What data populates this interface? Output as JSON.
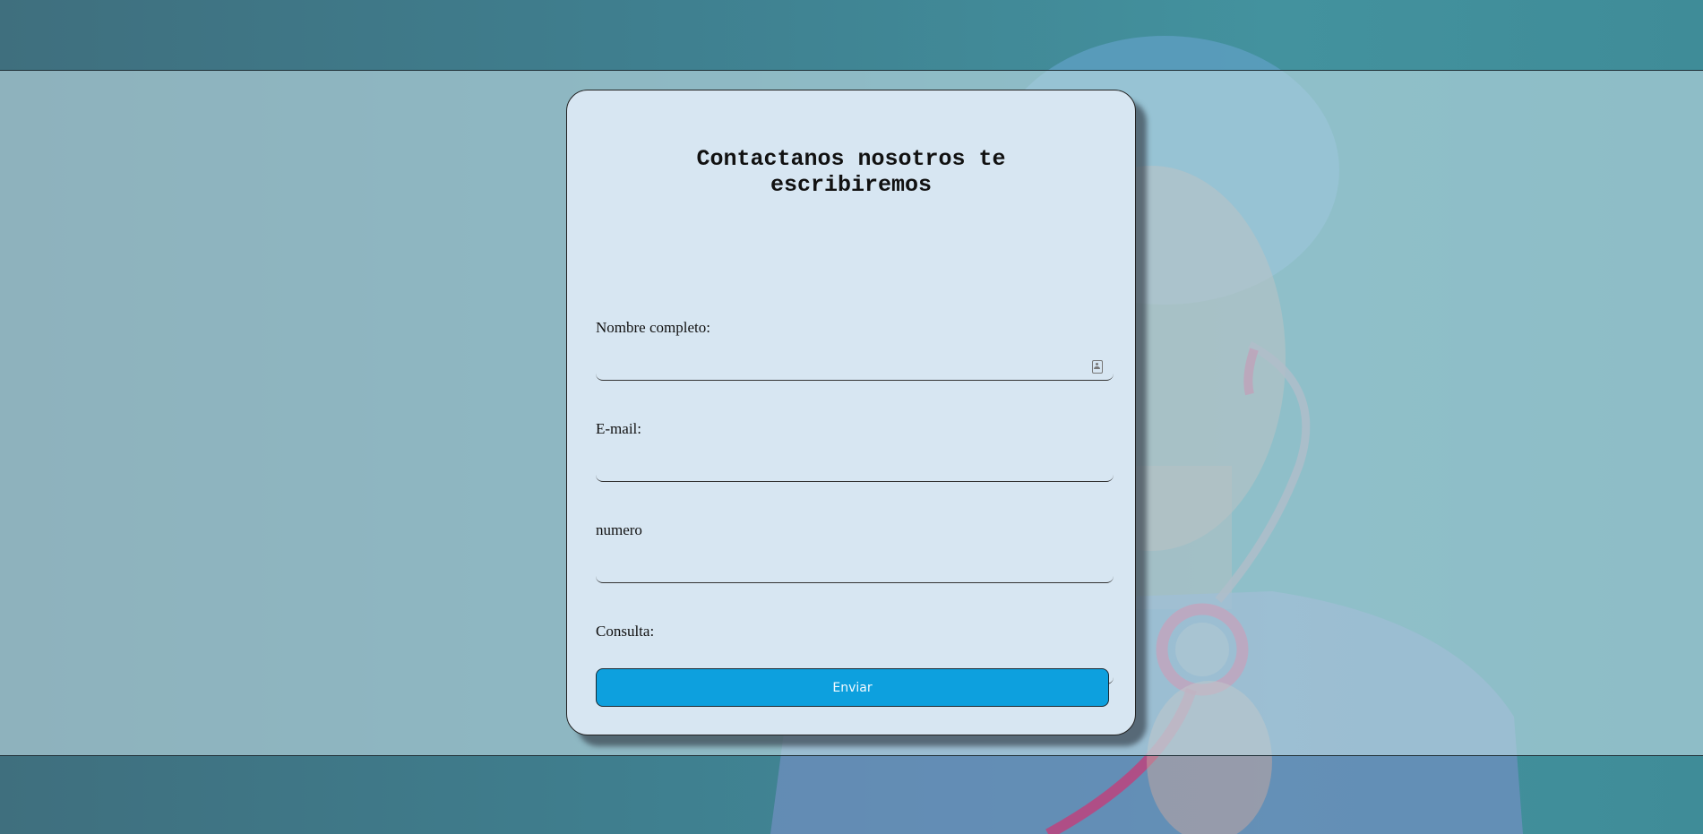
{
  "form": {
    "title": "Contactanos nosotros te escribiremos",
    "fields": [
      {
        "label": "Nombre completo:",
        "value": "",
        "placeholder": ""
      },
      {
        "label": "E-mail:",
        "value": "",
        "placeholder": ""
      },
      {
        "label": "numero",
        "value": "",
        "placeholder": ""
      },
      {
        "label": "Consulta:",
        "value": "",
        "placeholder": ""
      }
    ],
    "submit_label": "Enviar",
    "name_field_icon": "contact-card-icon"
  },
  "colors": {
    "button": "#0da0de",
    "card": "#d7e6f2",
    "background": "#43929e"
  }
}
